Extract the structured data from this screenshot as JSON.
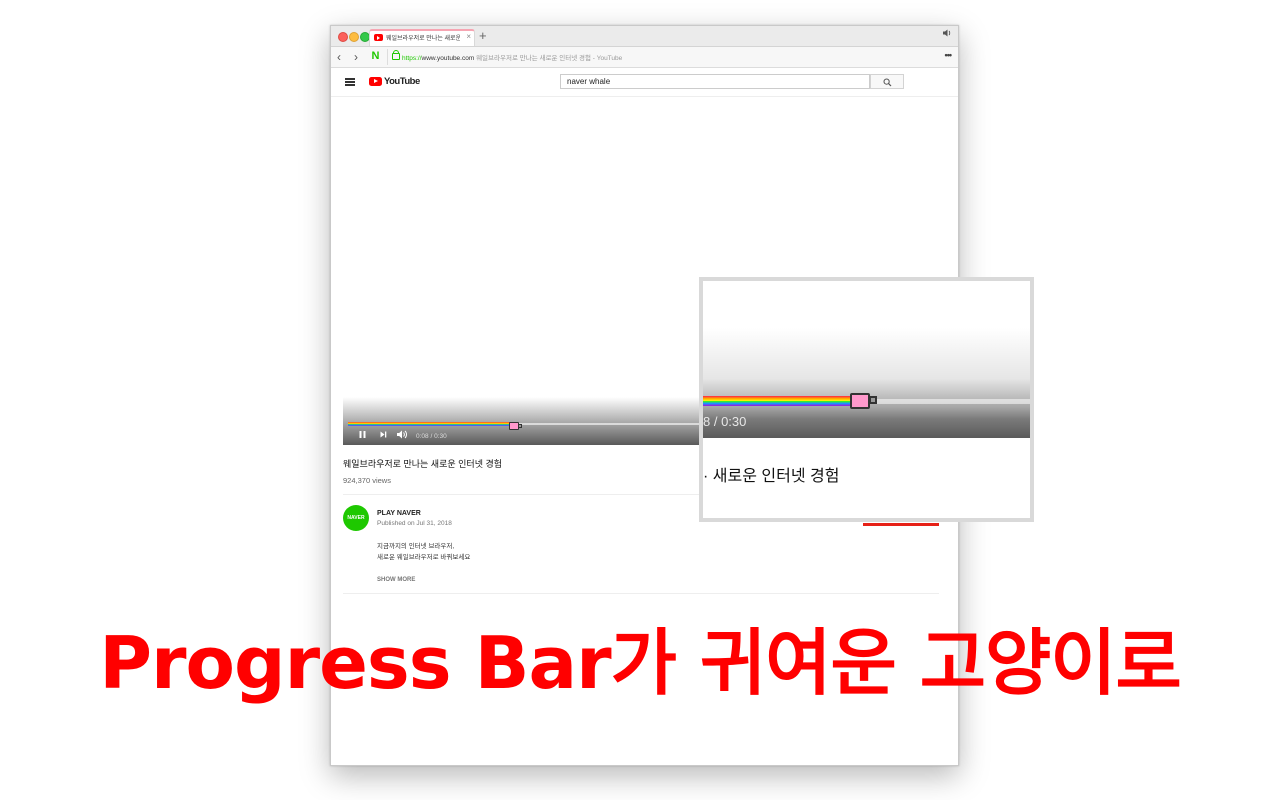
{
  "browser": {
    "tab_title": "웨일브라우저로 만나는 새로운",
    "tab_close": "×",
    "new_tab": "+",
    "speaker_icon": "speaker-icon",
    "back": "‹",
    "forward": "›",
    "naver_logo": "N",
    "url_protocol": "https://",
    "url_host": "www.youtube.com",
    "url_rest": " 웨일브라우저로 만나는 새로운 인터넷 경험 - YouTube",
    "menu": "•••"
  },
  "youtube": {
    "logo_text": "YouTube",
    "search_value": "naver whale",
    "player": {
      "time": "0:08 / 0:30",
      "progress_fraction": 0.28
    },
    "video_title": "웨일브라우저로 만나는 새로운 인터넷 경험",
    "views": "924,370 views",
    "channel": {
      "avatar_text": "NAVER",
      "name": "PLAY NAVER",
      "published": "Published on Jul 31, 2018"
    },
    "description": [
      "지금까지의 인터넷 브라우저,",
      "새로운 웨일브라우저로 바꿔보세요"
    ],
    "show_more": "SHOW MORE"
  },
  "zoom": {
    "time": "8 / 0:30",
    "title": "· 새로운 인터넷 경험",
    "progress_fraction": 0.45
  },
  "caption": "Progress Bar가 귀여운 고양이로",
  "colors": {
    "caption": "#ff0000",
    "naver_green": "#1ec800",
    "youtube_red": "#ff0000"
  }
}
